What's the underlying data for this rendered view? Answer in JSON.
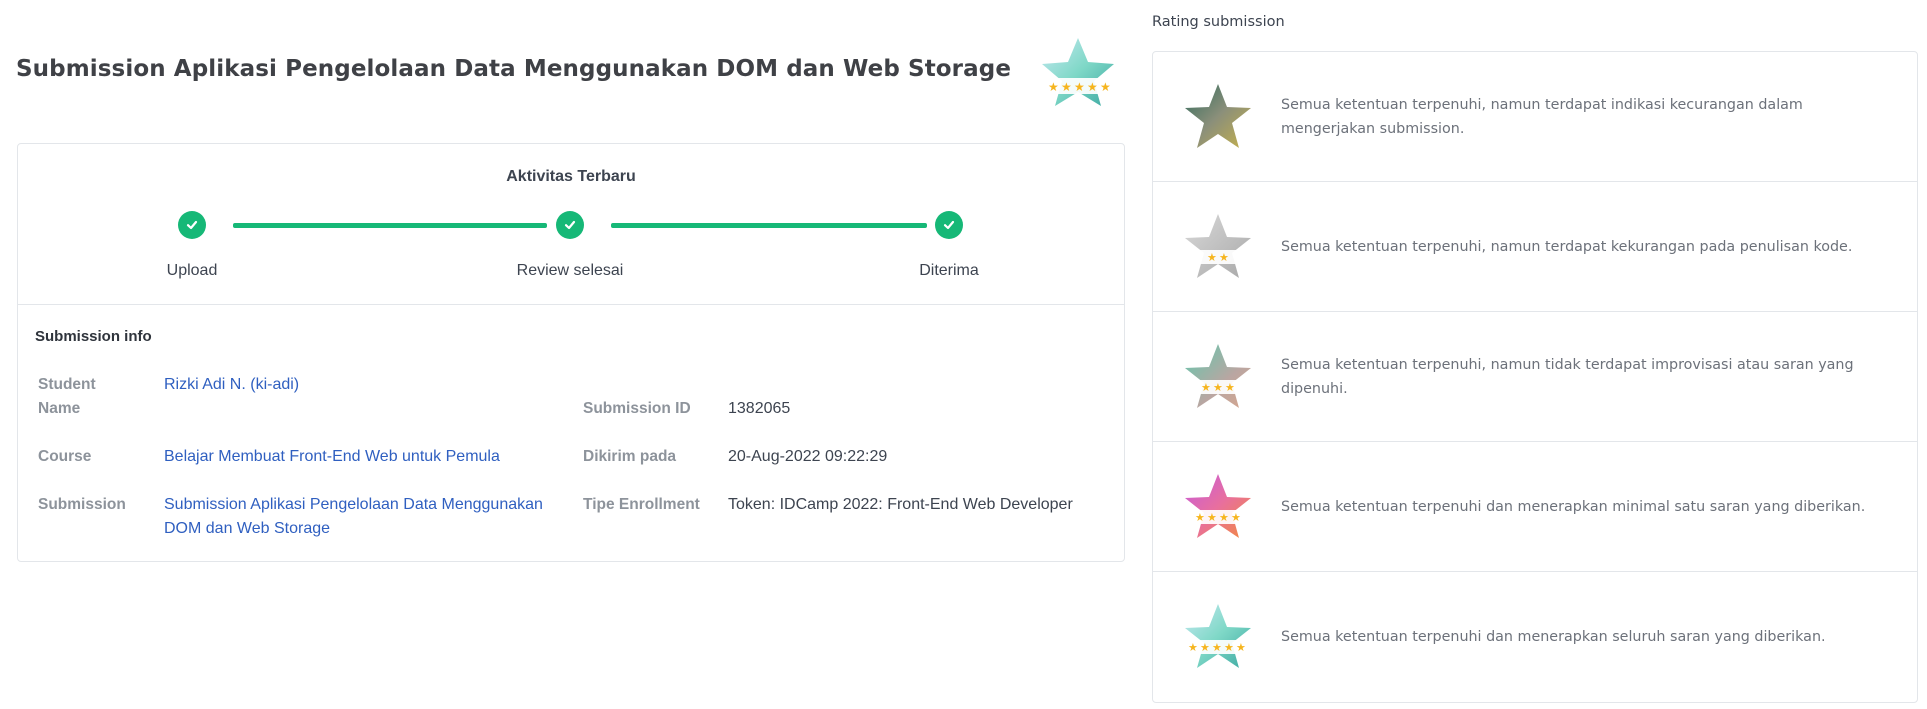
{
  "page": {
    "title": "Submission Aplikasi Pengelolaan Data Menggunakan DOM dan Web Storage",
    "badge_icon": "rating-5-star-badge-icon"
  },
  "activity": {
    "title": "Aktivitas Terbaru",
    "steps": [
      {
        "label": "Upload",
        "icon": "check-icon"
      },
      {
        "label": "Review selesai",
        "icon": "check-icon"
      },
      {
        "label": "Diterima",
        "icon": "check-icon"
      }
    ],
    "accent": "#16b877"
  },
  "submission_info": {
    "title": "Submission info",
    "student_name_label": "Student Name",
    "student_name_value": "Rizki Adi N. (ki-adi)",
    "course_label": "Course",
    "course_value": "Belajar Membuat Front-End Web untuk Pemula",
    "submission_label": "Submission",
    "submission_value": "Submission Aplikasi Pengelolaan Data Menggunakan DOM dan Web Storage",
    "submission_id_label": "Submission ID",
    "submission_id_value": "1382065",
    "sent_label": "Dikirim pada",
    "sent_value": "20-Aug-2022 09:22:29",
    "enrollment_label": "Tipe Enrollment",
    "enrollment_value": "Token: IDCamp 2022: Front-End Web Developer",
    "link_color": "#2f5fc0"
  },
  "rating": {
    "heading": "Rating submission",
    "items": [
      {
        "stars": 1,
        "icon": "star-rating-1-icon",
        "text": "Semua ketentuan terpenuhi, namun terdapat indikasi kecurangan dalam mengerjakan submission."
      },
      {
        "stars": 2,
        "icon": "star-rating-2-icon",
        "text": "Semua ketentuan terpenuhi, namun terdapat kekurangan pada penulisan kode."
      },
      {
        "stars": 3,
        "icon": "star-rating-3-icon",
        "text": "Semua ketentuan terpenuhi, namun tidak terdapat improvisasi atau saran yang dipenuhi."
      },
      {
        "stars": 4,
        "icon": "star-rating-4-icon",
        "text": "Semua ketentuan terpenuhi dan menerapkan minimal satu saran yang diberikan."
      },
      {
        "stars": 5,
        "icon": "star-rating-5-icon",
        "text": "Semua ketentuan terpenuhi dan menerapkan seluruh saran yang diberikan."
      }
    ]
  }
}
